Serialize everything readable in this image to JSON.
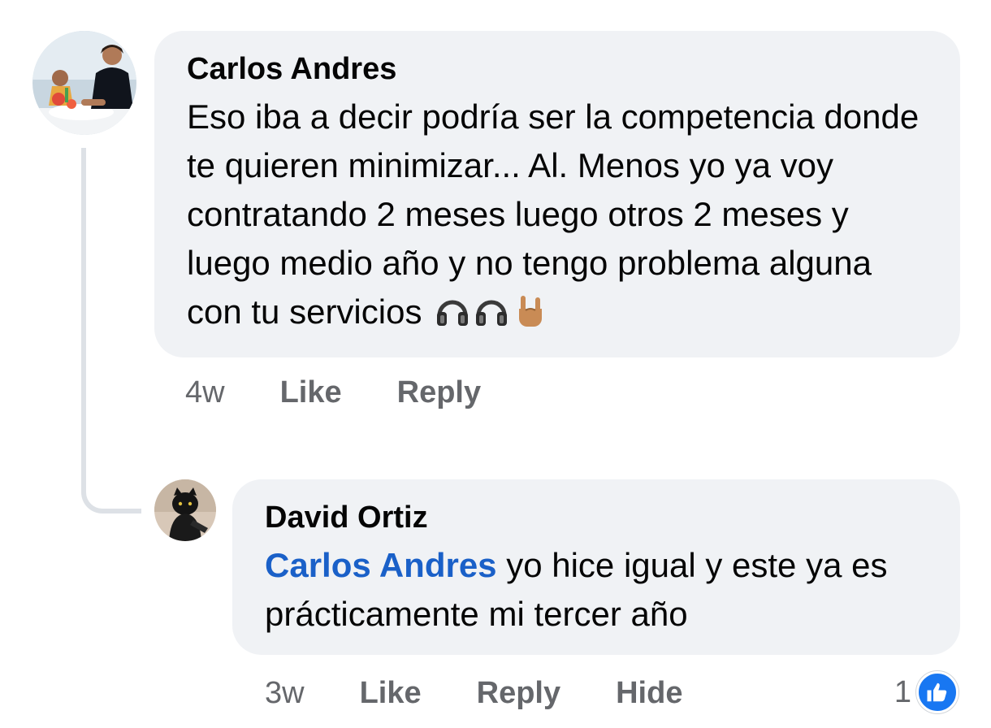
{
  "comments": [
    {
      "author": "Carlos Andres",
      "text": "Eso iba a decir podría ser la competencia donde te quieren minimizar... Al. Menos yo ya voy contratando 2 meses luego otros 2 meses y luego medio año y no tengo problema alguna con tu servicios",
      "emojis": [
        "headphones-icon",
        "headphones-icon",
        "horns-hand-icon"
      ],
      "time": "4w",
      "like_label": "Like",
      "reply_label": "Reply"
    },
    {
      "author": "David Ortiz",
      "mention": "Carlos Andres",
      "text": " yo hice igual y este ya es prácticamente mi tercer año",
      "time": "3w",
      "like_label": "Like",
      "reply_label": "Reply",
      "hide_label": "Hide",
      "reaction_count": "1",
      "reaction_icon": "thumbs-up-icon"
    }
  ],
  "colors": {
    "bubble": "#f0f2f5",
    "mention": "#1a60c8",
    "meta_text": "#65676b",
    "like_blue": "#1877f2"
  }
}
